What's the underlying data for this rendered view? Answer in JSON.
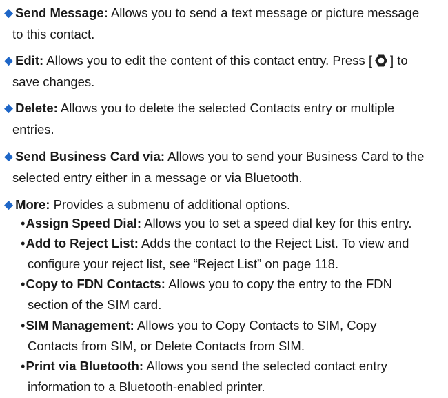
{
  "items": [
    {
      "term": "Send Message:",
      "line1": " Allows you to send a text message or picture message",
      "line2": "to this contact."
    },
    {
      "term": "Edit:",
      "line1_a": " Allows you to edit the content of this contact entry. Press [",
      "icon": "center-select-key-icon",
      "line1_b": "] to",
      "line2": "save changes."
    },
    {
      "term": "Delete:",
      "line1": " Allows you to delete the selected Contacts entry or multiple",
      "line2": "entries."
    },
    {
      "term": "Send Business Card via:",
      "line1": " Allows you to send your Business Card to the",
      "line2": "selected entry either in a message or via Bluetooth."
    },
    {
      "term": "More:",
      "line1": " Provides a submenu of additional options."
    }
  ],
  "subitems": [
    {
      "bullet": "•",
      "term": "Assign Speed Dial:",
      "line1": " Allows you to set a speed dial key for this entry."
    },
    {
      "bullet": "•",
      "term": "Add to Reject List:",
      "line1": " Adds the contact to the Reject List. To view and",
      "line2": "configure your reject list, see “Reject List” on page 118."
    },
    {
      "bullet": "•",
      "term": "Copy to FDN Contacts:",
      "line1": " Allows you to copy the entry to the FDN",
      "line2": "section of the SIM card."
    },
    {
      "bullet": "•",
      "term": "SIM Management:",
      "line1": " Allows you to Copy Contacts to SIM, Copy",
      "line2": "Contacts from SIM, or Delete Contacts from SIM."
    },
    {
      "bullet": "•",
      "term": "Print via Bluetooth:",
      "line1": " Allows you send the selected contact entry",
      "line2": "information to a Bluetooth-enabled printer."
    }
  ],
  "colors": {
    "bullet": "#1e66c7",
    "text": "#1a1a1a"
  }
}
